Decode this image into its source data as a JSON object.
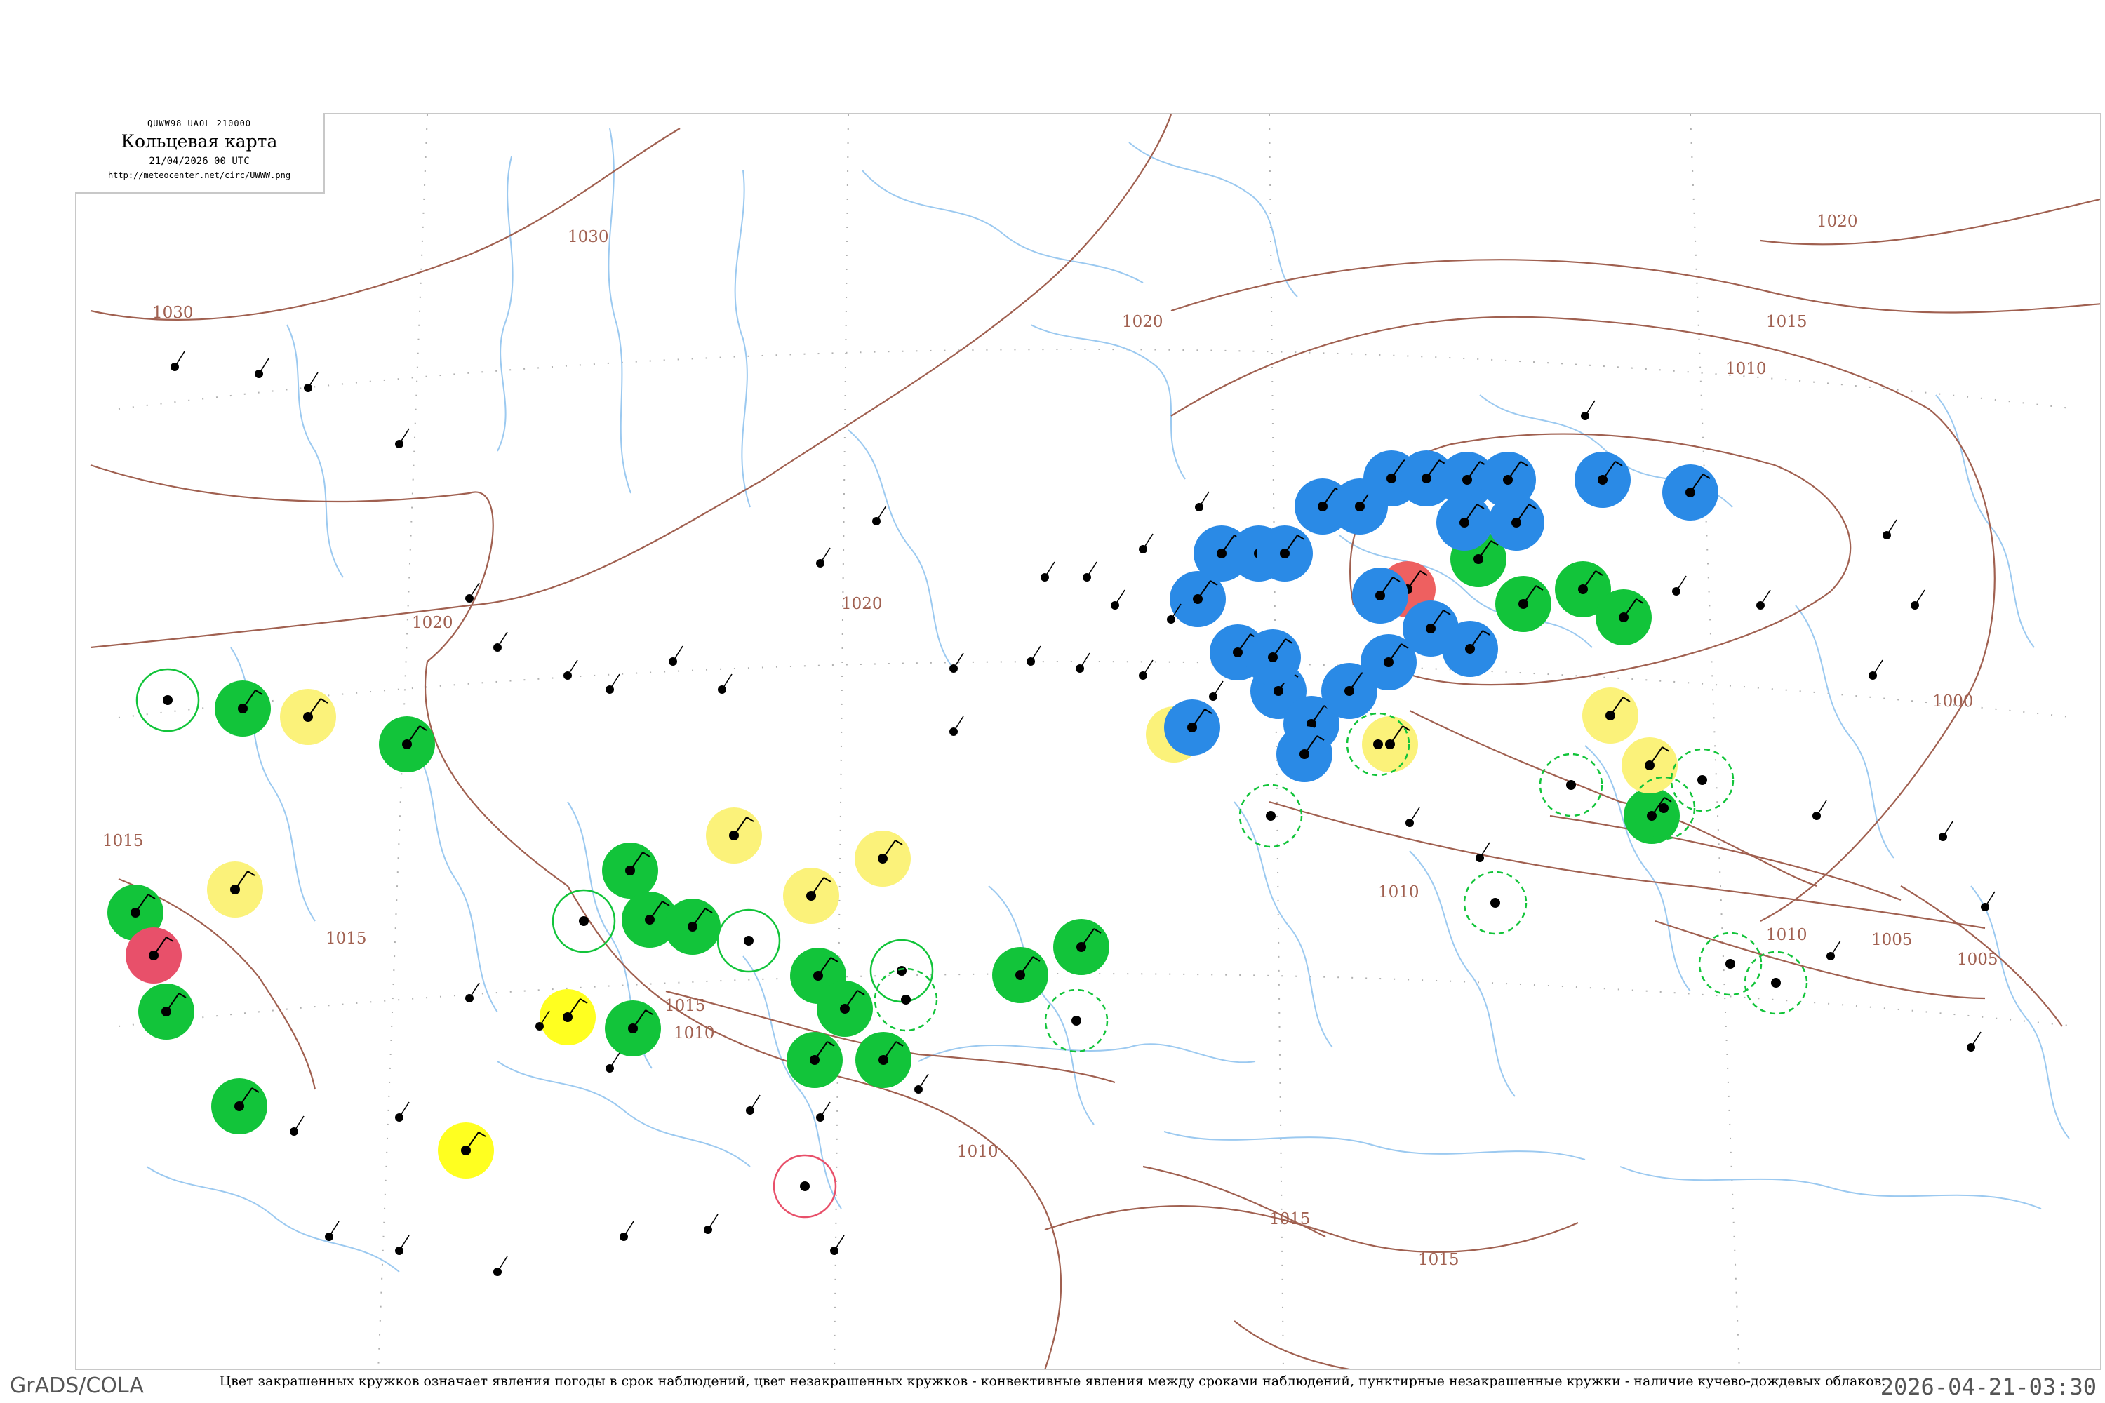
{
  "header": {
    "code": "QUWW98  UAOL  210000",
    "title": "Кольцевая карта",
    "date": "21/04/2026 00 UTC",
    "url": "http://meteocenter.net/circ/UWWW.png"
  },
  "caption": "Цвет закрашенных кружков означает явления погоды в срок наблюдений, цвет незакрашенных кружков - конвективные явления между сроками наблюдений, пунктирные незакрашенные кружки - наличие кучево-дождевых облаков.",
  "footer": {
    "left": "GrADS/COLA",
    "right": "2026-04-21-03:30"
  },
  "colors": {
    "isobar": "#a06050",
    "river": "#9bc9f0",
    "green": "#12c43a",
    "blue": "#2a8ae6",
    "yellow": "#fbf27a",
    "bright_yellow": "#ffff20",
    "red": "#ee6060",
    "magenta": "#e8506a"
  },
  "isobar_labels": [
    "1030",
    "1030",
    "1020",
    "1020",
    "1020",
    "1020",
    "1015",
    "1015",
    "1015",
    "1015",
    "1015",
    "1015",
    "1010",
    "1010",
    "1010",
    "1010",
    "1010",
    "1005",
    "1005",
    "1000"
  ],
  "station_circles": [
    {
      "type": "filled",
      "color": "green"
    },
    {
      "type": "filled",
      "color": "green"
    },
    {
      "type": "filled",
      "color": "green"
    },
    {
      "type": "filled",
      "color": "green"
    },
    {
      "type": "filled",
      "color": "green"
    },
    {
      "type": "filled",
      "color": "green"
    },
    {
      "type": "filled",
      "color": "green"
    },
    {
      "type": "filled",
      "color": "green"
    },
    {
      "type": "filled",
      "color": "green"
    },
    {
      "type": "filled",
      "color": "green"
    },
    {
      "type": "filled",
      "color": "green"
    },
    {
      "type": "filled",
      "color": "green"
    },
    {
      "type": "filled",
      "color": "green"
    },
    {
      "type": "filled",
      "color": "green"
    },
    {
      "type": "filled",
      "color": "green"
    },
    {
      "type": "filled",
      "color": "green"
    },
    {
      "type": "filled",
      "color": "green"
    },
    {
      "type": "filled",
      "color": "green"
    },
    {
      "type": "filled",
      "color": "green"
    },
    {
      "type": "filled",
      "color": "green"
    },
    {
      "type": "filled",
      "color": "yellow"
    },
    {
      "type": "filled",
      "color": "yellow"
    },
    {
      "type": "filled",
      "color": "yellow"
    },
    {
      "type": "filled",
      "color": "yellow"
    },
    {
      "type": "filled",
      "color": "yellow"
    },
    {
      "type": "filled",
      "color": "yellow"
    },
    {
      "type": "filled",
      "color": "yellow"
    },
    {
      "type": "filled",
      "color": "yellow"
    },
    {
      "type": "filled",
      "color": "yellow"
    },
    {
      "type": "filled",
      "color": "bright_yellow"
    },
    {
      "type": "filled",
      "color": "bright_yellow"
    },
    {
      "type": "filled",
      "color": "magenta"
    },
    {
      "type": "filled",
      "color": "red"
    },
    {
      "type": "filled",
      "color": "blue"
    },
    {
      "type": "filled",
      "color": "blue"
    },
    {
      "type": "filled",
      "color": "blue"
    },
    {
      "type": "filled",
      "color": "blue"
    },
    {
      "type": "filled",
      "color": "blue"
    },
    {
      "type": "filled",
      "color": "blue"
    },
    {
      "type": "filled",
      "color": "blue"
    },
    {
      "type": "filled",
      "color": "blue"
    },
    {
      "type": "filled",
      "color": "blue"
    },
    {
      "type": "filled",
      "color": "blue"
    },
    {
      "type": "filled",
      "color": "blue"
    },
    {
      "type": "filled",
      "color": "blue"
    },
    {
      "type": "filled",
      "color": "blue"
    },
    {
      "type": "filled",
      "color": "blue"
    },
    {
      "type": "filled",
      "color": "blue"
    },
    {
      "type": "filled",
      "color": "blue"
    },
    {
      "type": "filled",
      "color": "blue"
    },
    {
      "type": "filled",
      "color": "blue"
    },
    {
      "type": "filled",
      "color": "blue"
    },
    {
      "type": "filled",
      "color": "blue"
    },
    {
      "type": "filled",
      "color": "blue"
    },
    {
      "type": "filled",
      "color": "blue"
    },
    {
      "type": "filled",
      "color": "blue"
    },
    {
      "type": "filled",
      "color": "blue"
    },
    {
      "type": "filled",
      "color": "blue"
    },
    {
      "type": "outline",
      "color": "green"
    },
    {
      "type": "outline",
      "color": "green"
    },
    {
      "type": "outline",
      "color": "green"
    },
    {
      "type": "outline",
      "color": "green"
    },
    {
      "type": "outline",
      "color": "magenta"
    },
    {
      "type": "dashed",
      "color": "green"
    },
    {
      "type": "dashed",
      "color": "green"
    },
    {
      "type": "dashed",
      "color": "green"
    },
    {
      "type": "dashed",
      "color": "green"
    },
    {
      "type": "dashed",
      "color": "green"
    },
    {
      "type": "dashed",
      "color": "green"
    },
    {
      "type": "dashed",
      "color": "green"
    },
    {
      "type": "dashed",
      "color": "green"
    },
    {
      "type": "dashed",
      "color": "green"
    },
    {
      "type": "dashed",
      "color": "green"
    }
  ]
}
